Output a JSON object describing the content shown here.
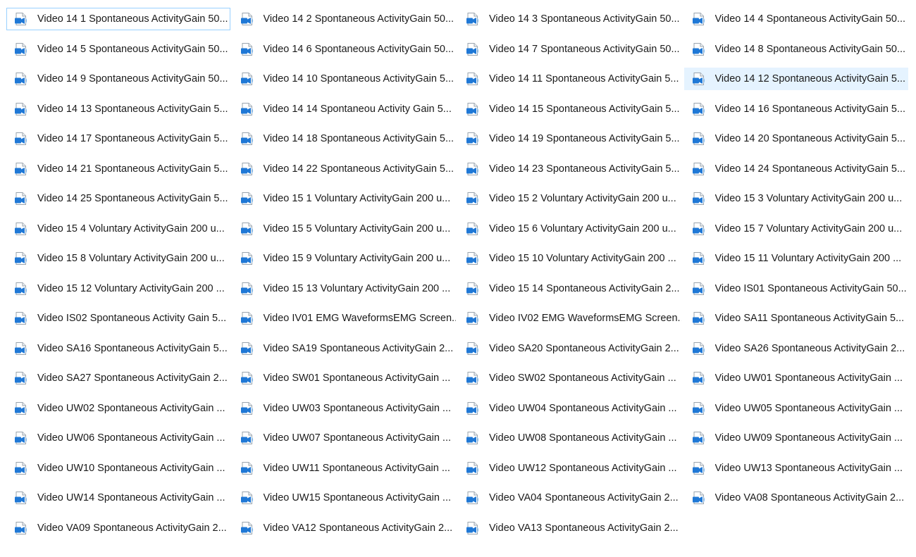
{
  "icon": {
    "name": "video-file-icon",
    "accent": "#1f78d6",
    "light": "#8fc3f3"
  },
  "selection": {
    "focused_index": 0,
    "hovered_index": 11,
    "hover_bg": "#e5f3ff",
    "focus_border": "#99d1ff"
  },
  "files": [
    "Video 14 1 Spontaneous ActivityGain 50...",
    "Video 14 2 Spontaneous ActivityGain 50...",
    "Video 14 3 Spontaneous ActivityGain 50...",
    "Video 14 4 Spontaneous ActivityGain 50...",
    "Video 14 5 Spontaneous ActivityGain 50...",
    "Video 14 6 Spontaneous ActivityGain 50...",
    "Video 14 7 Spontaneous ActivityGain 50...",
    "Video 14 8 Spontaneous ActivityGain 50...",
    "Video 14 9 Spontaneous ActivityGain 50...",
    "Video 14 10 Spontaneous ActivityGain 5...",
    "Video 14 11 Spontaneous ActivityGain 5...",
    "Video 14 12 Spontaneous ActivityGain 5...",
    "Video 14 13 Spontaneous ActivityGain 5...",
    "Video 14 14 Spontaneou Activity Gain 5...",
    "Video 14 15 Spontaneous ActivityGain 5...",
    "Video 14 16 Spontaneous ActivityGain 5...",
    "Video 14 17 Spontaneous ActivityGain 5...",
    "Video 14 18 Spontaneous ActivityGain 5...",
    "Video 14 19 Spontaneous ActivityGain 5...",
    "Video 14 20 Spontaneous ActivityGain 5...",
    "Video 14 21 Spontaneous ActivityGain 5...",
    "Video 14 22 Spontaneous ActivityGain 5...",
    "Video 14 23 Spontaneous ActivityGain 5...",
    "Video 14 24 Spontaneous ActivityGain 5...",
    "Video 14 25 Spontaneous ActivityGain 5...",
    "Video 15 1 Voluntary ActivityGain 200 u...",
    "Video 15 2 Voluntary ActivityGain 200 u...",
    "Video 15 3 Voluntary ActivityGain 200 u...",
    "Video 15 4 Voluntary ActivityGain 200 u...",
    "Video 15 5 Voluntary ActivityGain 200 u...",
    "Video 15 6 Voluntary ActivityGain 200 u...",
    "Video 15 7 Voluntary ActivityGain 200 u...",
    "Video 15 8 Voluntary ActivityGain 200 u...",
    "Video 15 9 Voluntary ActivityGain 200 u...",
    "Video 15 10 Voluntary ActivityGain 200 ...",
    "Video 15 11 Voluntary ActivityGain 200 ...",
    "Video 15 12 Voluntary ActivityGain 200 ...",
    "Video 15 13 Voluntary ActivityGain 200 ...",
    "Video 15 14 Spontaneous ActivityGain 2...",
    "Video IS01 Spontaneous ActivityGain 50...",
    "Video IS02 Spontaneous Activity Gain 5...",
    "Video IV01 EMG WaveformsEMG Screen...",
    "Video IV02 EMG WaveformsEMG Screen...",
    "Video SA11 Spontaneous ActivityGain 5...",
    "Video SA16 Spontaneous ActivityGain 5...",
    "Video SA19 Spontaneous ActivityGain 2...",
    "Video SA20 Spontaneous ActivityGain 2...",
    "Video SA26 Spontaneous ActivityGain 2...",
    "Video SA27 Spontaneous ActivityGain 2...",
    "Video SW01 Spontaneous ActivityGain ...",
    "Video SW02 Spontaneous ActivityGain ...",
    "Video UW01 Spontaneous ActivityGain ...",
    "Video UW02 Spontaneous ActivityGain ...",
    "Video UW03 Spontaneous ActivityGain ...",
    "Video UW04 Spontaneous ActivityGain ...",
    "Video UW05 Spontaneous ActivityGain ...",
    "Video UW06 Spontaneous ActivityGain ...",
    "Video UW07 Spontaneous ActivityGain ...",
    "Video UW08 Spontaneous ActivityGain ...",
    "Video UW09 Spontaneous ActivityGain ...",
    "Video UW10 Spontaneous ActivityGain ...",
    "Video UW11 Spontaneous ActivityGain ...",
    "Video UW12 Spontaneous ActivityGain ...",
    "Video UW13 Spontaneous ActivityGain ...",
    "Video UW14 Spontaneous ActivityGain ...",
    "Video UW15 Spontaneous ActivityGain ...",
    "Video VA04 Spontaneous ActivityGain 2...",
    "Video VA08 Spontaneous ActivityGain 2...",
    "Video VA09 Spontaneous ActivityGain 2...",
    "Video VA12 Spontaneous ActivityGain 2...",
    "Video VA13 Spontaneous ActivityGain 2..."
  ]
}
